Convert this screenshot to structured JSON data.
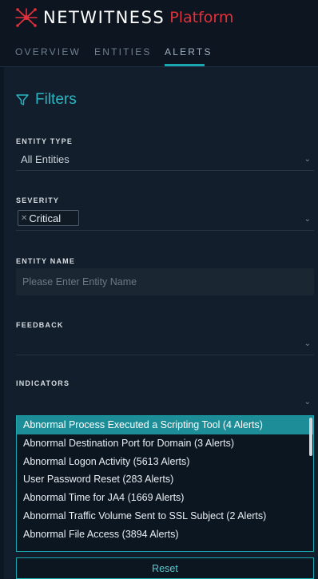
{
  "brand": {
    "name": "NETWITNESS",
    "suffix": "Platform"
  },
  "tabs": [
    {
      "label": "OVERVIEW",
      "active": false
    },
    {
      "label": "ENTITIES",
      "active": false
    },
    {
      "label": "ALERTS",
      "active": true
    }
  ],
  "filters": {
    "title": "Filters",
    "entity_type": {
      "label": "ENTITY TYPE",
      "value": "All Entities"
    },
    "severity": {
      "label": "SEVERITY",
      "tag": "Critical"
    },
    "entity_name": {
      "label": "ENTITY NAME",
      "placeholder": "Please Enter Entity Name"
    },
    "feedback": {
      "label": "FEEDBACK",
      "value": ""
    },
    "indicators": {
      "label": "INDICATORS",
      "options": [
        "Abnormal Process Executed a Scripting Tool (4 Alerts)",
        "Abnormal Destination Port for Domain (3 Alerts)",
        "Abnormal Logon Activity (5613 Alerts)",
        "User Password Reset (283 Alerts)",
        "Abnormal Time for JA4 (1669 Alerts)",
        "Abnormal Traffic Volume Sent to SSL Subject (2 Alerts)",
        "Abnormal File Access (3894 Alerts)"
      ],
      "highlighted_index": 0
    },
    "reset_label": "Reset"
  },
  "colors": {
    "accent": "#1aa7b0",
    "brand_red": "#e0313c",
    "background": "#0b1723",
    "panel": "#121e2b"
  }
}
